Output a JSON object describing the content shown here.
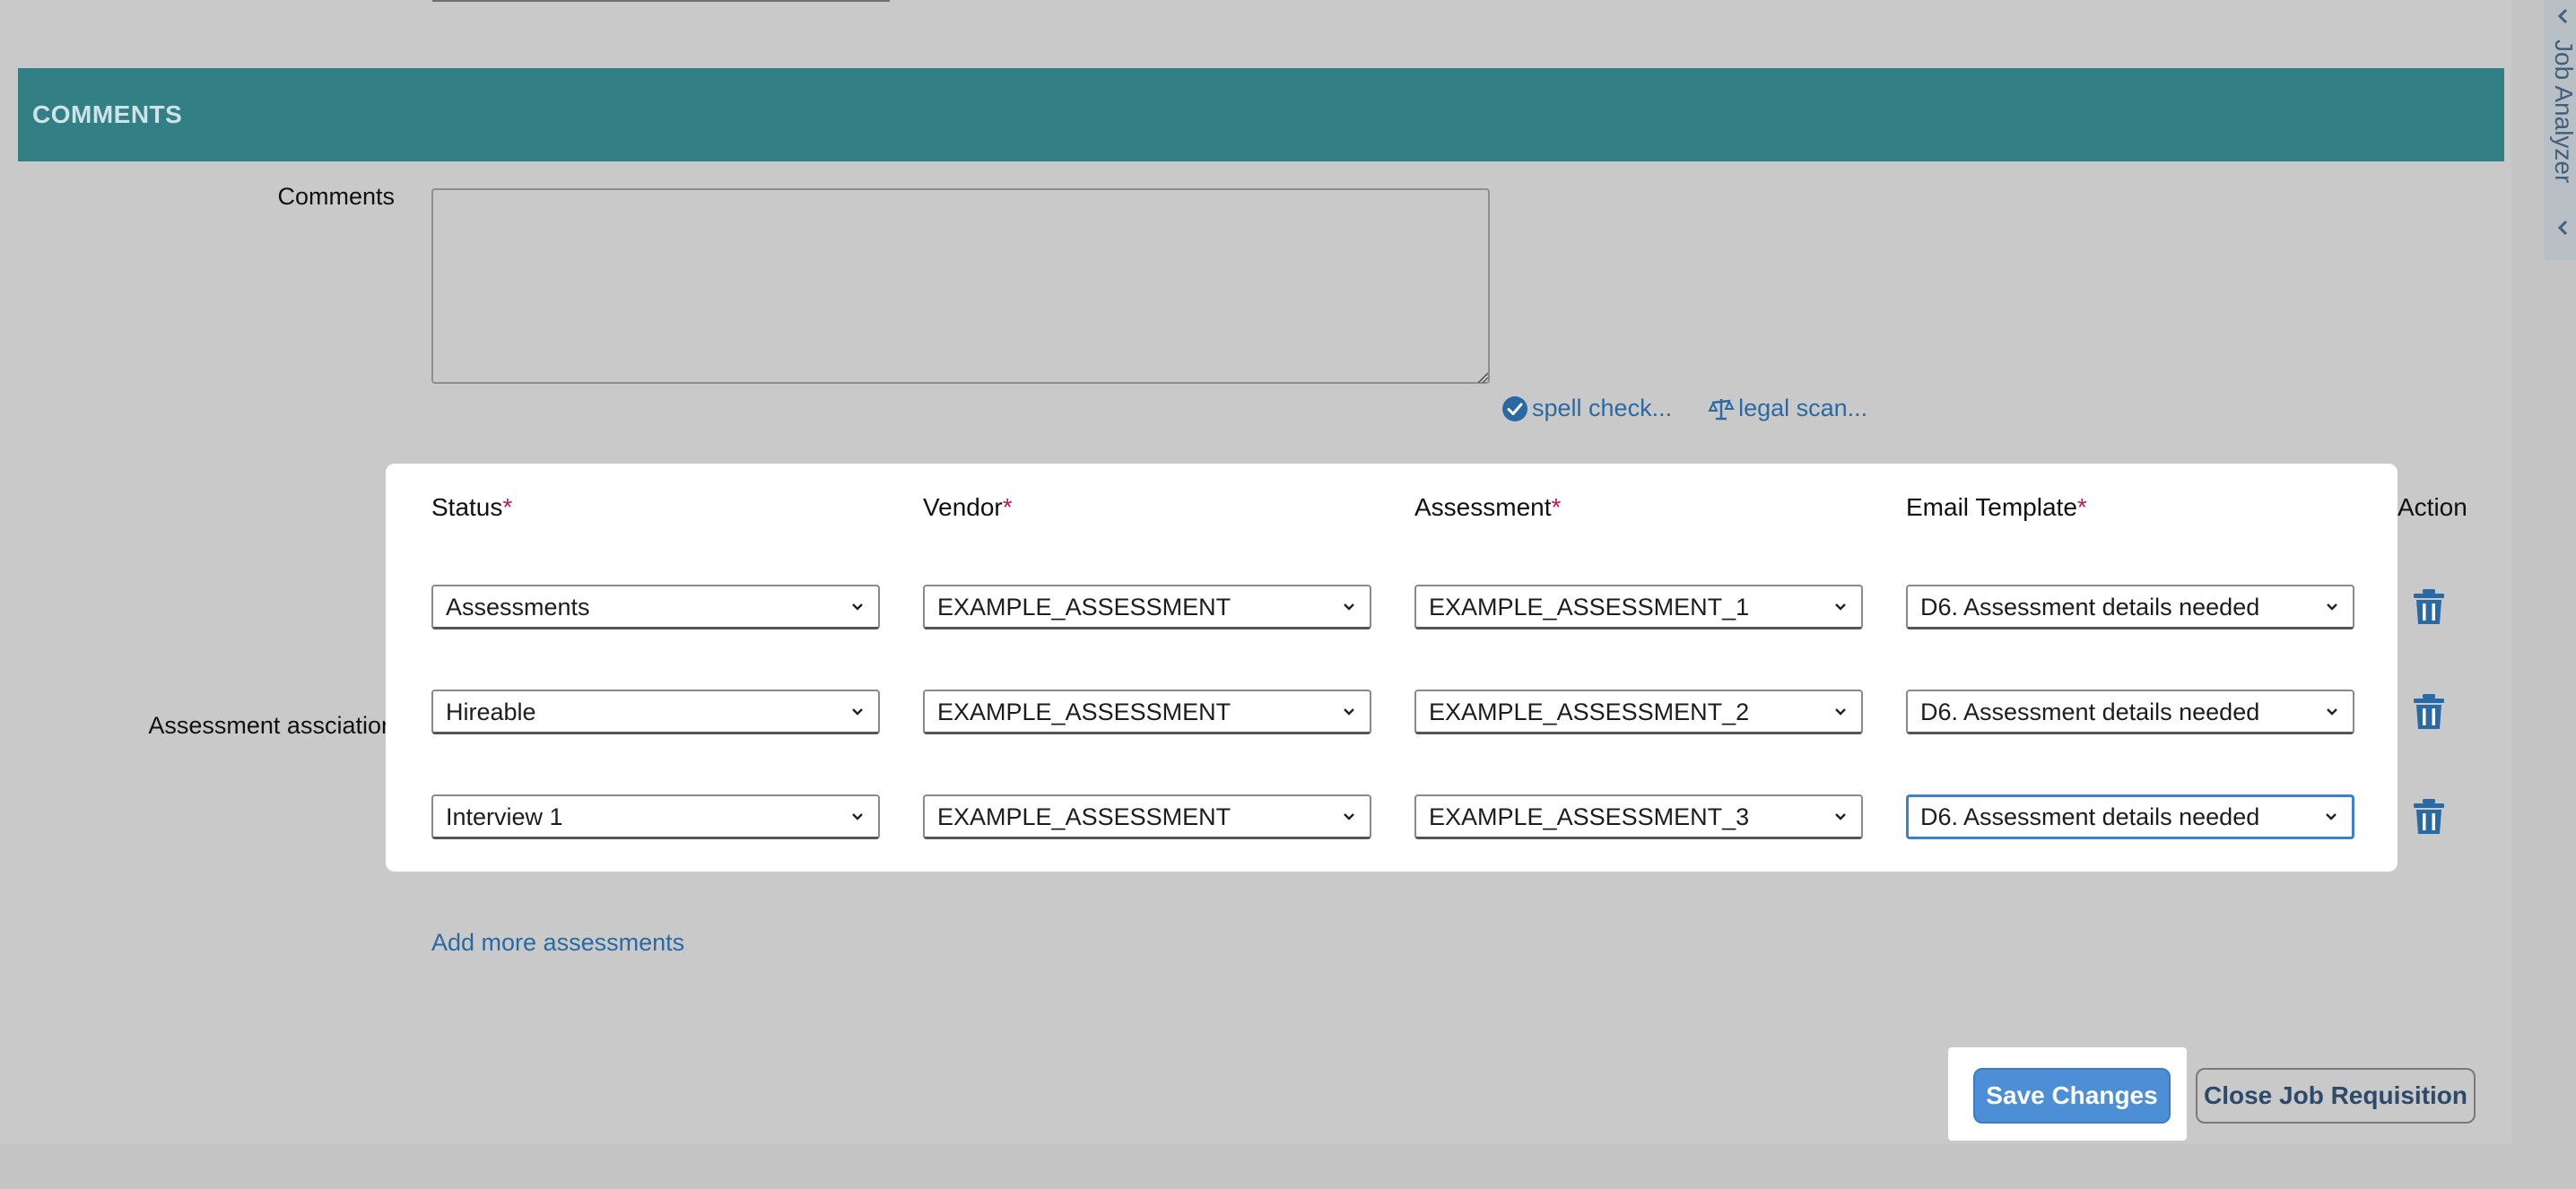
{
  "section": {
    "title": "COMMENTS"
  },
  "comments": {
    "label": "Comments",
    "value": "",
    "spell_check": "spell check...",
    "legal_scan": "legal scan..."
  },
  "assessment": {
    "label": "Assessment assciation",
    "headers": {
      "status": "Status",
      "vendor": "Vendor",
      "assessment": "Assessment",
      "email_template": "Email Template",
      "action": "Action",
      "required_mark": "*"
    },
    "rows": [
      {
        "status": "Assessments",
        "vendor": "EXAMPLE_ASSESSMENT",
        "assessment": "EXAMPLE_ASSESSMENT_1",
        "email_template": "D6. Assessment details needed"
      },
      {
        "status": "Hireable",
        "vendor": "EXAMPLE_ASSESSMENT",
        "assessment": "EXAMPLE_ASSESSMENT_2",
        "email_template": "D6. Assessment details needed"
      },
      {
        "status": "Interview 1",
        "vendor": "EXAMPLE_ASSESSMENT",
        "assessment": "EXAMPLE_ASSESSMENT_3",
        "email_template": "D6. Assessment details needed"
      }
    ],
    "add_more": "Add more assessments"
  },
  "footer": {
    "save": "Save Changes",
    "close": "Close Job Requisition"
  },
  "side_panel": {
    "label": "Job Analyzer"
  },
  "icons": {
    "spell": "check-circle-icon",
    "legal": "scale-icon",
    "delete": "trash-icon",
    "dropdown": "chevron-down-icon"
  },
  "colors": {
    "section_bar": "#337f86",
    "link": "#2a6aa4",
    "primary_button": "#4d8fd6",
    "required": "#c2185b",
    "focus": "#3d7fd0"
  }
}
